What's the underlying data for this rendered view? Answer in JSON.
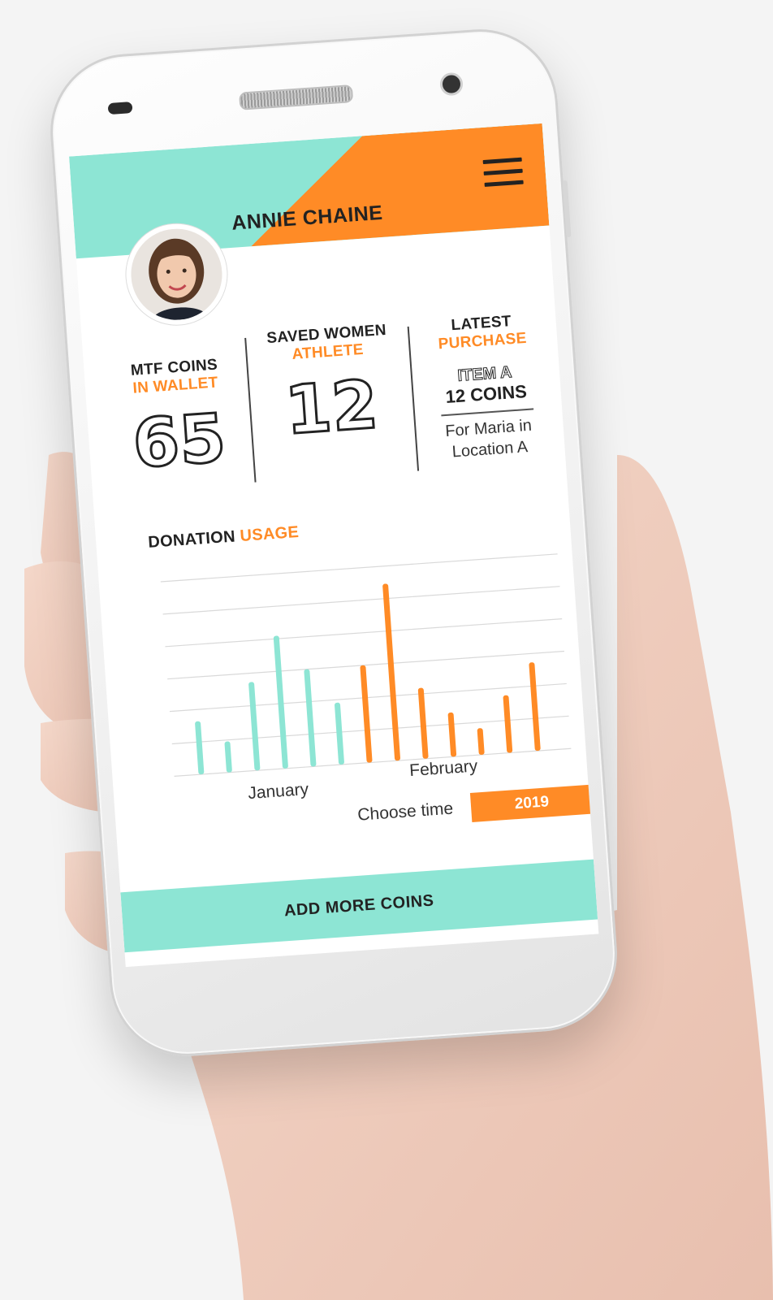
{
  "profile": {
    "name": "ANNIE CHAINE"
  },
  "stats": {
    "coins": {
      "title": "MTF COINS",
      "subtitle": "IN WALLET",
      "value": "65"
    },
    "saved": {
      "title": "SAVED WOMEN",
      "subtitle": "ATHLETE",
      "value": "12"
    },
    "latest": {
      "title": "LATEST",
      "subtitle": "PURCHASE",
      "item": "ITEM A",
      "coins": "12 COINS",
      "for_line1": "For Maria in",
      "for_line2": "Location A"
    }
  },
  "chart_title": {
    "main": "DONATION",
    "accent": "USAGE"
  },
  "chart_data": {
    "type": "bar",
    "title": "DONATION USAGE",
    "categories": [
      "January",
      "February"
    ],
    "series": [
      {
        "month": "January",
        "color": "#8de5d4",
        "values": [
          60,
          35,
          100,
          150,
          110,
          70
        ]
      },
      {
        "month": "February",
        "color": "#ff8b26",
        "values": [
          110,
          200,
          80,
          50,
          30,
          65,
          100
        ]
      }
    ],
    "ylim": [
      0,
      220
    ],
    "grid": true,
    "xtick_labels": [
      "January",
      "February"
    ]
  },
  "time_select": {
    "label": "Choose time",
    "value": "2019"
  },
  "cta": {
    "label": "ADD MORE COINS"
  },
  "colors": {
    "teal": "#8de5d4",
    "orange": "#ff8b26",
    "text": "#222222"
  },
  "icons": {
    "menu": "hamburger-menu-icon"
  }
}
